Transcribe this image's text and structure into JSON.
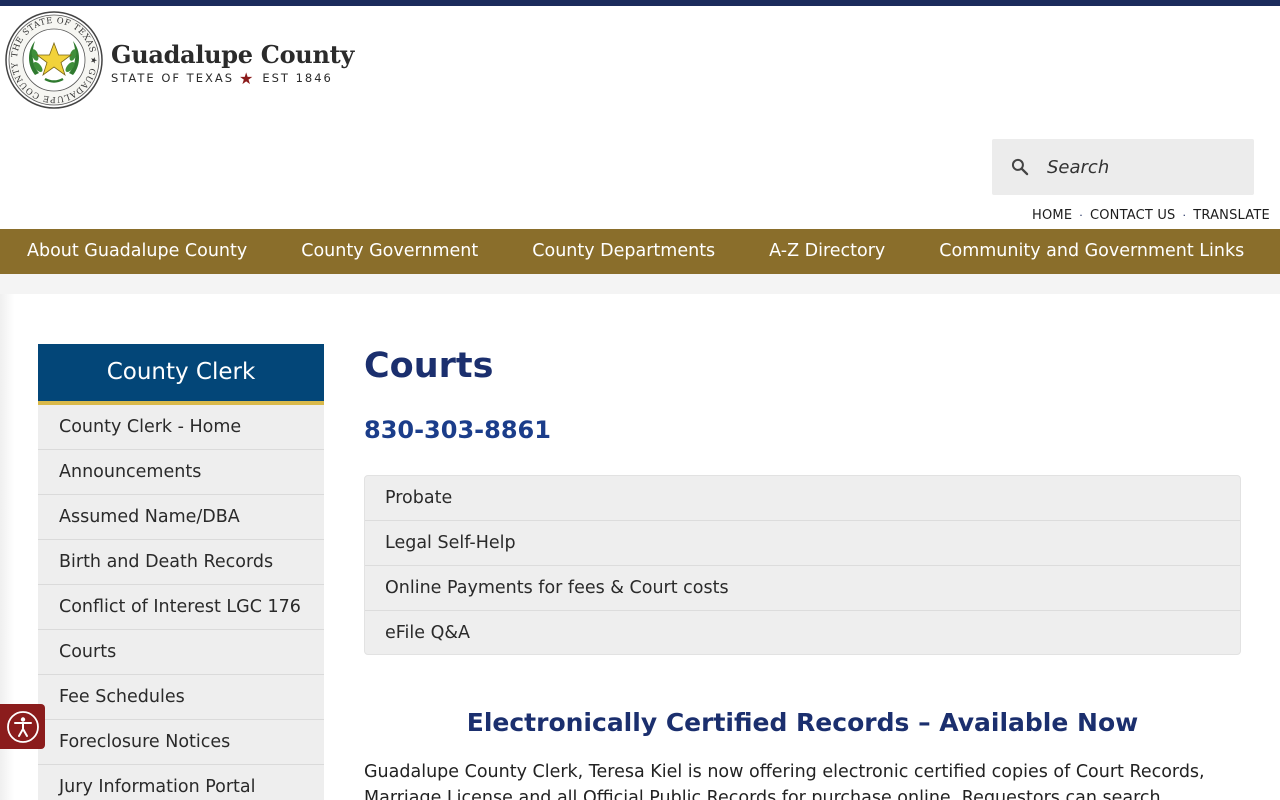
{
  "header": {
    "seal_text": "THE STATE OF TEXAS · GUADALUPE COUNTY",
    "brand_title": "Guadalupe County",
    "brand_state": "STATE OF TEXAS",
    "brand_est": "EST 1846",
    "search_placeholder": "Search",
    "util_links": [
      "HOME",
      "CONTACT US",
      "TRANSLATE"
    ]
  },
  "nav": {
    "items": [
      "About Guadalupe County",
      "County Government",
      "County Departments",
      "A-Z Directory",
      "Community and Government Links"
    ]
  },
  "sidebar": {
    "title": "County Clerk",
    "items": [
      "County Clerk - Home",
      "Announcements",
      "Assumed Name/DBA",
      "Birth and Death Records",
      "Conflict of Interest LGC 176",
      "Courts",
      "Fee Schedules",
      "Foreclosure Notices",
      "Jury Information Portal"
    ]
  },
  "main": {
    "title": "Courts",
    "phone": "830-303-8861",
    "subnav": [
      "Probate",
      "Legal Self-Help",
      "Online Payments for fees & Court costs",
      "eFile Q&A"
    ],
    "section_heading": "Electronically Certified Records – Available Now",
    "body_text": "Guadalupe County Clerk, Teresa Kiel is now offering electronic certified copies of Court Records, Marriage License and all Official Public Records for purchase online. Requestors can search"
  },
  "colors": {
    "top_strip": "#1b2b5c",
    "nav_bg": "#8a6e2b",
    "sidebar_header_bg": "#034678",
    "sidebar_accent": "#d9b94a",
    "heading_blue": "#1b2f6e",
    "accessibility_button": "#8b1c1c"
  },
  "icons": {
    "search": "magnifier-icon",
    "accessibility": "accessibility-person-icon",
    "brand_star": "star-icon"
  }
}
